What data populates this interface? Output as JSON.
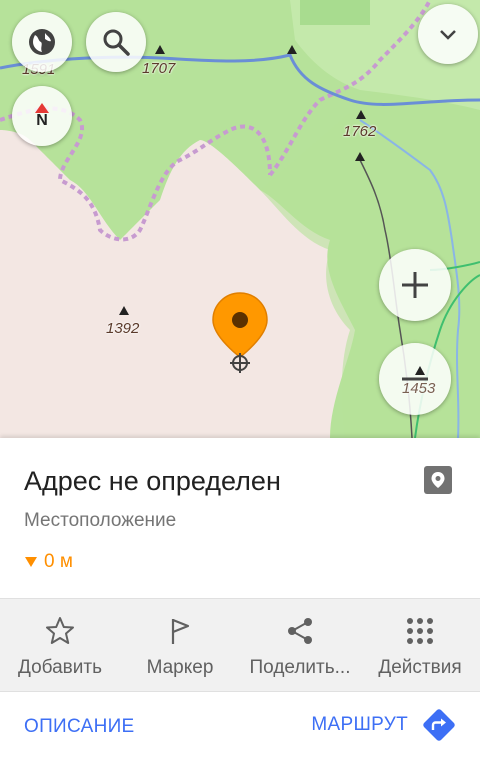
{
  "map": {
    "peaks": [
      {
        "id": "peak-1591",
        "label": "1591"
      },
      {
        "id": "peak-1707",
        "label": "1707"
      },
      {
        "id": "peak-1762",
        "label": "1762"
      },
      {
        "id": "peak-1392",
        "label": "1392"
      },
      {
        "id": "peak-1453",
        "label": "1453"
      }
    ],
    "compass_label": "N",
    "buttons": {
      "layers": "globe-icon",
      "search": "search-icon",
      "collapse": "chevron-down-icon",
      "zoom_in": "plus-icon",
      "zoom_out": "minus-icon"
    }
  },
  "place": {
    "title": "Адрес не определен",
    "subtitle": "Местоположение",
    "distance": "0 м"
  },
  "actions": [
    {
      "label": "Добавить",
      "icon": "star-icon"
    },
    {
      "label": "Маркер",
      "icon": "flag-icon"
    },
    {
      "label": "Поделить...",
      "icon": "share-icon"
    },
    {
      "label": "Действия",
      "icon": "grid-dots-icon"
    }
  ],
  "bottom": {
    "description": "ОПИСАНИЕ",
    "route": "МАРШРУТ"
  },
  "colors": {
    "accent": "#3d6ff5",
    "pin": "#ff9800",
    "forest": "#b6e29a",
    "land": "#f3e7e3"
  }
}
